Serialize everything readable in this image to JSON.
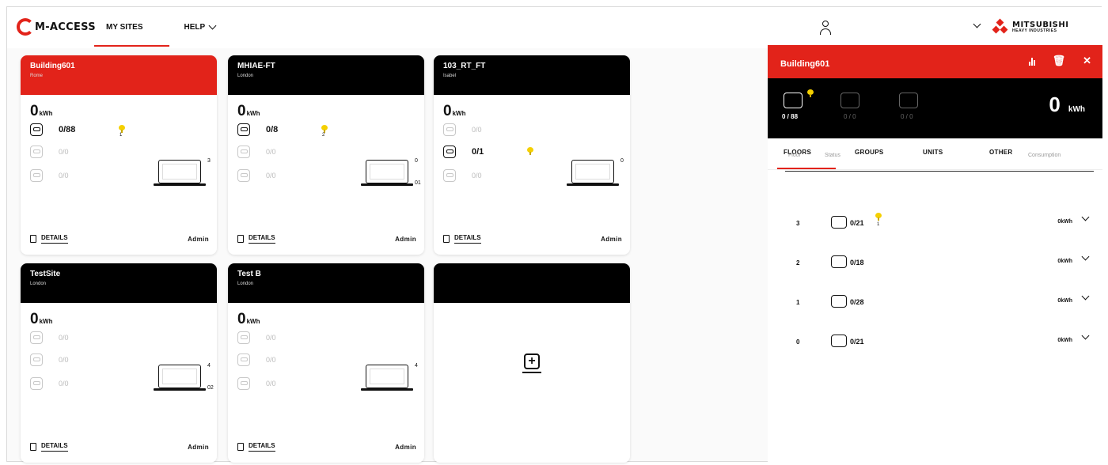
{
  "app": {
    "logo_text": "M-ACCESS"
  },
  "nav": {
    "my_sites": "MY SITES",
    "help": "HELP"
  },
  "brand": {
    "line1": "MITSUBISHI",
    "line2": "HEAVY INDUSTRIES"
  },
  "sites": [
    {
      "title": "Building601",
      "location": "Rome",
      "header_color": "#e2231a",
      "kwh": "0",
      "kwh_unit": "kWh",
      "stats": [
        "0/88",
        "0/0",
        "0/0"
      ],
      "bulb_count": "1",
      "device_count": "3",
      "device_sub": "",
      "details": "DETAILS",
      "role": "Admin"
    },
    {
      "title": "MHIAE-FT",
      "location": "London",
      "header_color": "#000000",
      "kwh": "0",
      "kwh_unit": "kWh",
      "stats": [
        "0/8",
        "0/0",
        "0/0"
      ],
      "bulb_count": "2",
      "device_count": "0",
      "device_sub": "01",
      "details": "DETAILS",
      "role": "Admin"
    },
    {
      "title": "103_RT_FT",
      "location": "Isabel",
      "header_color": "#000000",
      "kwh": "0",
      "kwh_unit": "kWh",
      "stats": [
        "0/0",
        "0/1",
        "0/0"
      ],
      "bulb_count": "",
      "device_count": "0",
      "device_sub": "",
      "details": "DETAILS",
      "role": "Admin"
    },
    {
      "title": "TestSite",
      "location": "London",
      "header_color": "#000000",
      "kwh": "0",
      "kwh_unit": "kWh",
      "stats": [
        "0/0",
        "0/0",
        "0/0"
      ],
      "bulb_count": "",
      "device_count": "4",
      "device_sub": "02",
      "details": "DETAILS",
      "role": "Admin"
    },
    {
      "title": "Test B",
      "location": "London",
      "header_color": "#000000",
      "kwh": "0",
      "kwh_unit": "kWh",
      "stats": [
        "0/0",
        "0/0",
        "0/0"
      ],
      "bulb_count": "",
      "device_count": "4",
      "device_sub": "",
      "details": "DETAILS",
      "role": "Admin"
    }
  ],
  "panel": {
    "title": "Building601",
    "stats": [
      "0 / 88",
      "0 / 0",
      "0 / 0"
    ],
    "kwh": "0",
    "kwh_unit": "kWh",
    "tabs": [
      "FLOORS",
      "GROUPS",
      "UNITS",
      "OTHER"
    ],
    "col_floor": "Floor",
    "col_status": "Status",
    "col_consumption": "Consumption",
    "floors": [
      {
        "floor": "3",
        "units": "0/21",
        "bulb_count": "1",
        "consumption": "0kWh"
      },
      {
        "floor": "2",
        "units": "0/18",
        "bulb_count": "",
        "consumption": "0kWh"
      },
      {
        "floor": "1",
        "units": "0/28",
        "bulb_count": "",
        "consumption": "0kWh"
      },
      {
        "floor": "0",
        "units": "0/21",
        "bulb_count": "",
        "consumption": "0kWh"
      }
    ]
  },
  "colors": {
    "accent": "#e2231a",
    "bulb": "#f5d000"
  }
}
